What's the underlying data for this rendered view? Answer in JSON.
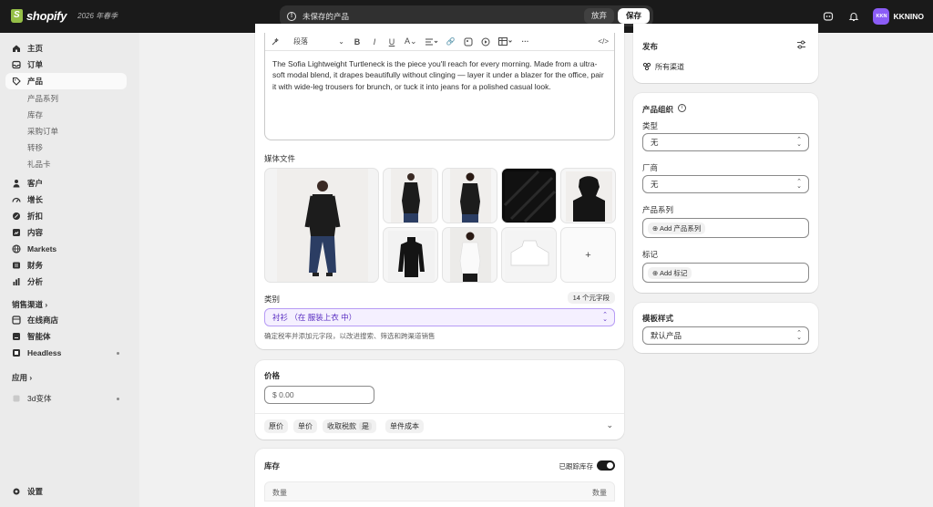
{
  "topbar": {
    "brand": "shopify",
    "season": "2026 年春季",
    "unsaved_text": "未保存的产品",
    "discard_label": "放弃",
    "save_label": "保存",
    "avatar_initials": "KKN",
    "user_name": "KKNINO"
  },
  "sidebar": {
    "items": [
      {
        "label": "主页",
        "icon": "home-icon"
      },
      {
        "label": "订单",
        "icon": "inbox-icon"
      },
      {
        "label": "产品",
        "icon": "tag-icon"
      }
    ],
    "product_sub": [
      "产品系列",
      "库存",
      "采购订单",
      "转移",
      "礼品卡"
    ],
    "items2": [
      {
        "label": "客户",
        "icon": "person-icon"
      },
      {
        "label": "增长",
        "icon": "gauge-icon"
      },
      {
        "label": "折扣",
        "icon": "discount-icon"
      },
      {
        "label": "内容",
        "icon": "content-icon"
      },
      {
        "label": "Markets",
        "icon": "globe-icon"
      },
      {
        "label": "财务",
        "icon": "bank-icon"
      },
      {
        "label": "分析",
        "icon": "chart-icon"
      }
    ],
    "sales_channels": "销售渠道",
    "channels": [
      {
        "label": "在线商店",
        "icon": "store-icon"
      },
      {
        "label": "智能体",
        "icon": "agent-icon"
      },
      {
        "label": "Headless",
        "icon": "headless-icon"
      }
    ],
    "apps": "应用",
    "app_items": [
      {
        "label": "3d变体",
        "icon": "app-icon"
      }
    ],
    "settings": "设置"
  },
  "editor": {
    "paragraph_label": "段落",
    "description": "The Sofia Lightweight Turtleneck is the piece you'll reach for every morning. Made from a ultra-soft modal blend, it drapes beautifully without clinging — layer it under a blazer for the office, pair it with wide-leg trousers for brunch, or tuck it into jeans for a polished casual look."
  },
  "media": {
    "label": "媒体文件",
    "add_symbol": "+"
  },
  "category": {
    "label": "类别",
    "metafield_count": "14 个元字段",
    "value": "衬衫 （在 服装上衣 中）",
    "hint": "确定税率并添加元字段，以改进搜索、筛选和跨渠道销售"
  },
  "price": {
    "title": "价格",
    "placeholder": "$ 0.00",
    "chips": [
      "原价",
      "单价",
      "收取税款",
      "单件成本"
    ],
    "tax_value": "是"
  },
  "inventory": {
    "title": "库存",
    "tracked_label": "已跟踪库存",
    "col_left": "数量",
    "col_right": "数量"
  },
  "publish": {
    "title": "发布",
    "channels_label": "所有渠道"
  },
  "organization": {
    "title": "产品组织",
    "type_label": "类型",
    "type_value": "无",
    "vendor_label": "厂商",
    "vendor_value": "无",
    "collections_label": "产品系列",
    "collections_btn": "Add 产品系列",
    "tags_label": "标记",
    "tags_btn": "Add 标记"
  },
  "template": {
    "title": "模板样式",
    "value": "默认产品"
  }
}
